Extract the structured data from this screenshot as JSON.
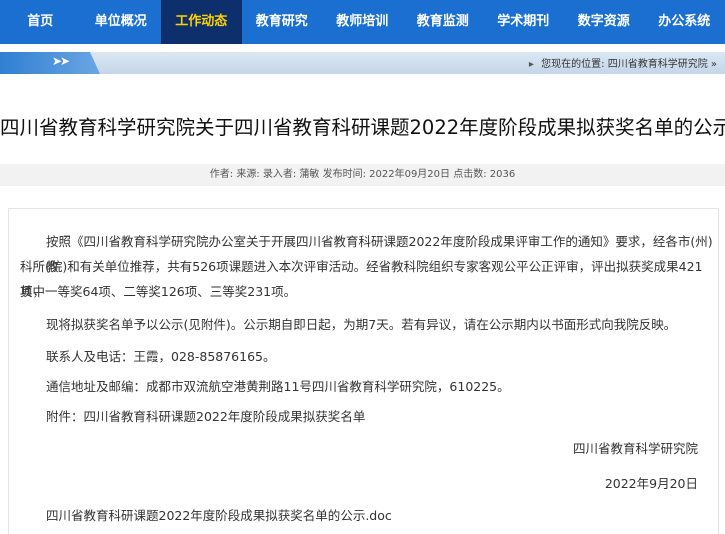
{
  "nav": {
    "items": [
      "首页",
      "单位概况",
      "工作动态",
      "教育研究",
      "教师培训",
      "教育监测",
      "学术期刊",
      "数字资源",
      "办公系统"
    ],
    "active_index": 2
  },
  "location": {
    "arrows": "➤➤",
    "prefix": "您现在的位置:",
    "path": "四川省教育科学研究院 »"
  },
  "article": {
    "title": "四川省教育科学研究院关于四川省教育科研课题2022年度阶段成果拟获奖名单的公示",
    "meta": "作者:  来源:  录入者: 蒲敏 发布时间: 2022年09月20日 点击数:  2036",
    "para1_line1": "按照《四川省教育科学研究院办公室关于开展四川省教育科研课题2022年度阶段成果评审工作的通知》要求，经各市(州)教",
    "para1_line2": "科所(院)和有关单位推荐，共有526项课题进入本次评审活动。经省教科院组织专家客观公平公正评审，评出拟获奖成果421项，",
    "para1_line3": "其中一等奖64项、二等奖126项、三等奖231项。",
    "para2": "现将拟获奖名单予以公示(见附件)。公示期自即日起，为期7天。若有异议，请在公示期内以书面形式向我院反映。",
    "contact": "联系人及电话：王霞，028-85876165。",
    "address": "通信地址及邮编：成都市双流航空港黄荆路11号四川省教育科学研究院，610225。",
    "attachment_note": "附件：四川省教育科研课题2022年度阶段成果拟获奖名单",
    "signature": "四川省教育科学研究院",
    "date": "2022年9月20日",
    "attachment_file": "四川省教育科研课题2022年度阶段成果拟获奖名单的公示.doc"
  }
}
